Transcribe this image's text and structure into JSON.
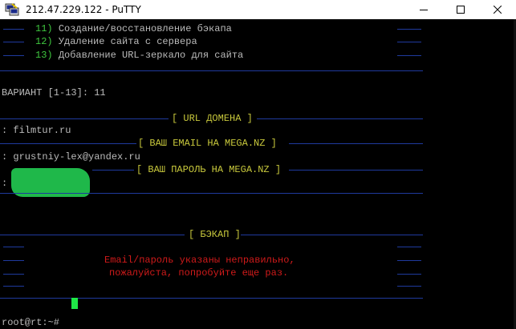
{
  "window": {
    "title": "212.47.229.122 - PuTTY",
    "icon": "putty-icon"
  },
  "menu": [
    {
      "num": "11)",
      "text": "Создание/восстановление бэкапа"
    },
    {
      "num": "12)",
      "text": "Удаление сайта с сервера"
    },
    {
      "num": "13)",
      "text": "Добавление URL-зеркало для сайта"
    }
  ],
  "prompt_variant": "ВАРИАНТ [1-13]: 11",
  "domain": {
    "header": "URL ДОМЕНА",
    "value": ": filmtur.ru"
  },
  "email": {
    "header": "ВАШ EMAIL НА MEGA.NZ",
    "value": ": grustniy-lex@yandex.ru"
  },
  "password": {
    "header": "ВАШ ПАРОЛЬ НА MEGA.NZ",
    "value": ":"
  },
  "backup": {
    "header": "БЭКАП",
    "error_line1": "Email/пароль указаны неправильно,",
    "error_line2": "пожалуйста, попробуйте еще раз."
  },
  "shell_prompt": "root@rt:~#",
  "colors": {
    "menu_number": "#3fc83f",
    "header": "#c8c83c",
    "error": "#d01a1a",
    "rule": "#1f3a9e",
    "cursor": "#1ee846",
    "text": "#bbbbbb"
  }
}
